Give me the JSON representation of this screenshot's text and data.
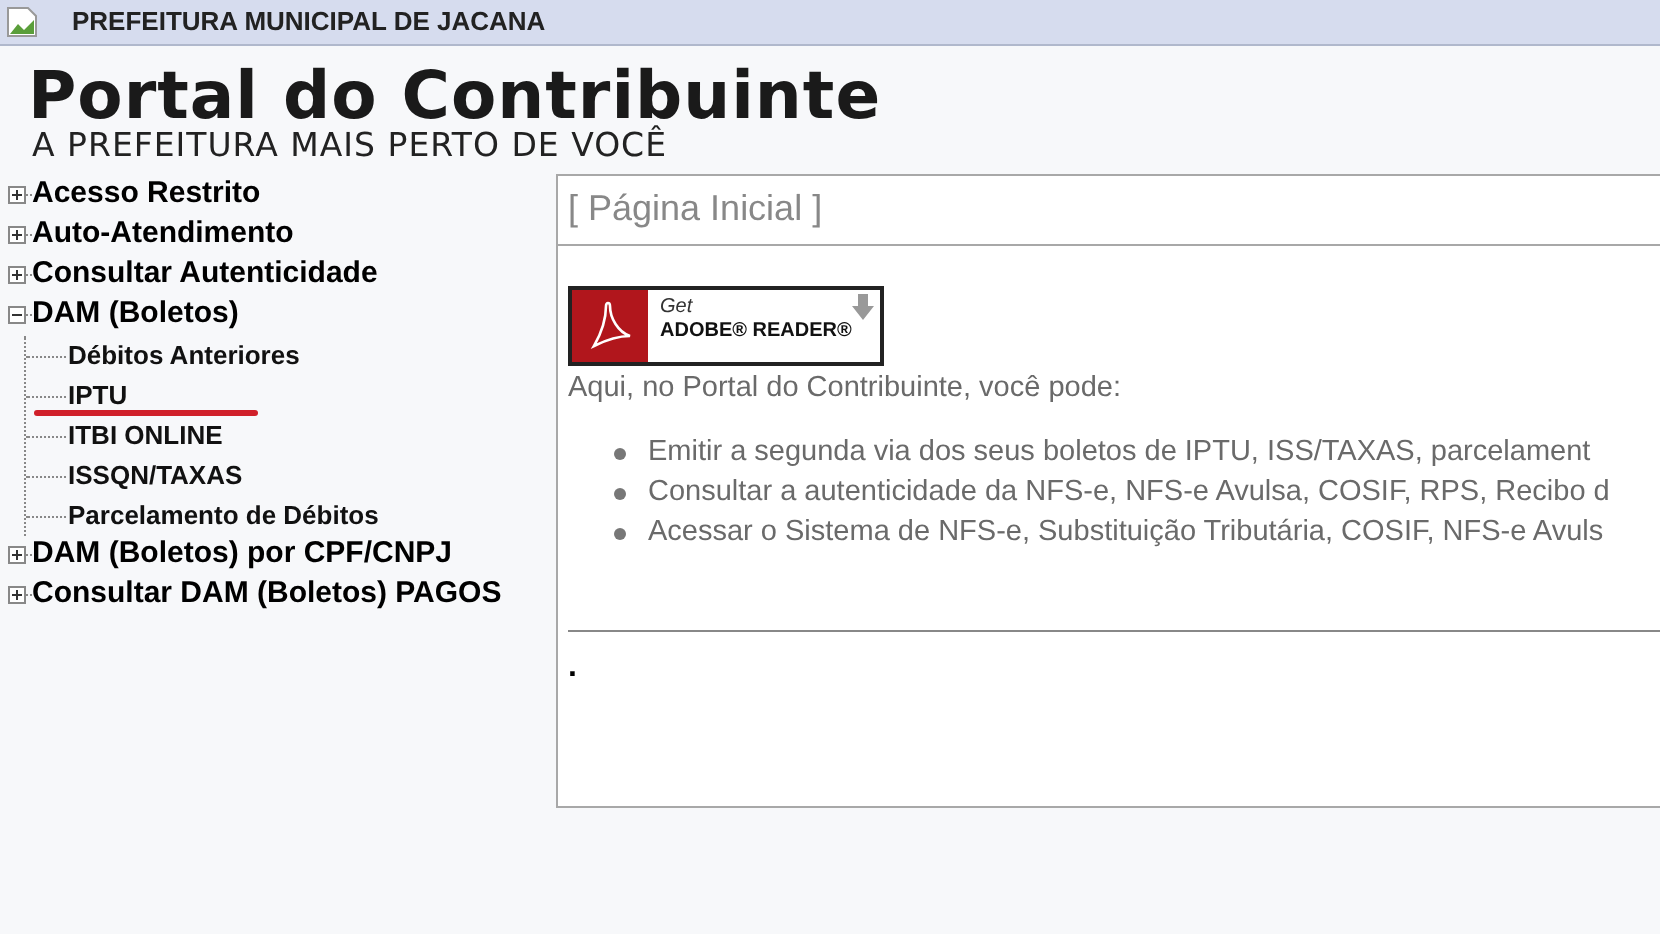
{
  "header": {
    "title": "PREFEITURA MUNICIPAL DE JACANA"
  },
  "logo": {
    "title": "Portal do Contribuinte",
    "subtitle": "A PREFEITURA MAIS PERTO DE VOCÊ"
  },
  "menu": [
    {
      "label": "Acesso Restrito",
      "expanded": false
    },
    {
      "label": "Auto-Atendimento",
      "expanded": false
    },
    {
      "label": "Consultar Autenticidade",
      "expanded": false
    },
    {
      "label": "DAM (Boletos)",
      "expanded": true,
      "children": [
        {
          "label": "Débitos Anteriores",
          "selected": false
        },
        {
          "label": "IPTU",
          "selected": true
        },
        {
          "label": "ITBI ONLINE",
          "selected": false
        },
        {
          "label": "ISSQN/TAXAS",
          "selected": false
        },
        {
          "label": "Parcelamento de Débitos",
          "selected": false
        }
      ]
    },
    {
      "label": "DAM (Boletos) por CPF/CNPJ",
      "expanded": false
    },
    {
      "label": "Consultar DAM (Boletos) PAGOS",
      "expanded": false
    }
  ],
  "content": {
    "title": "[ Página Inicial ]",
    "badge": {
      "line1": "Get",
      "line2": "ADOBE® READER®"
    },
    "intro": "Aqui, no Portal do Contribuinte, você pode:",
    "bullets": [
      "Emitir a segunda via dos seus boletos de IPTU, ISS/TAXAS, parcelament",
      "Consultar a autenticidade da NFS-e, NFS-e Avulsa, COSIF, RPS, Recibo d",
      "Acessar o Sistema de NFS-e, Substituição Tributária, COSIF, NFS-e Avuls"
    ],
    "footer": "."
  }
}
